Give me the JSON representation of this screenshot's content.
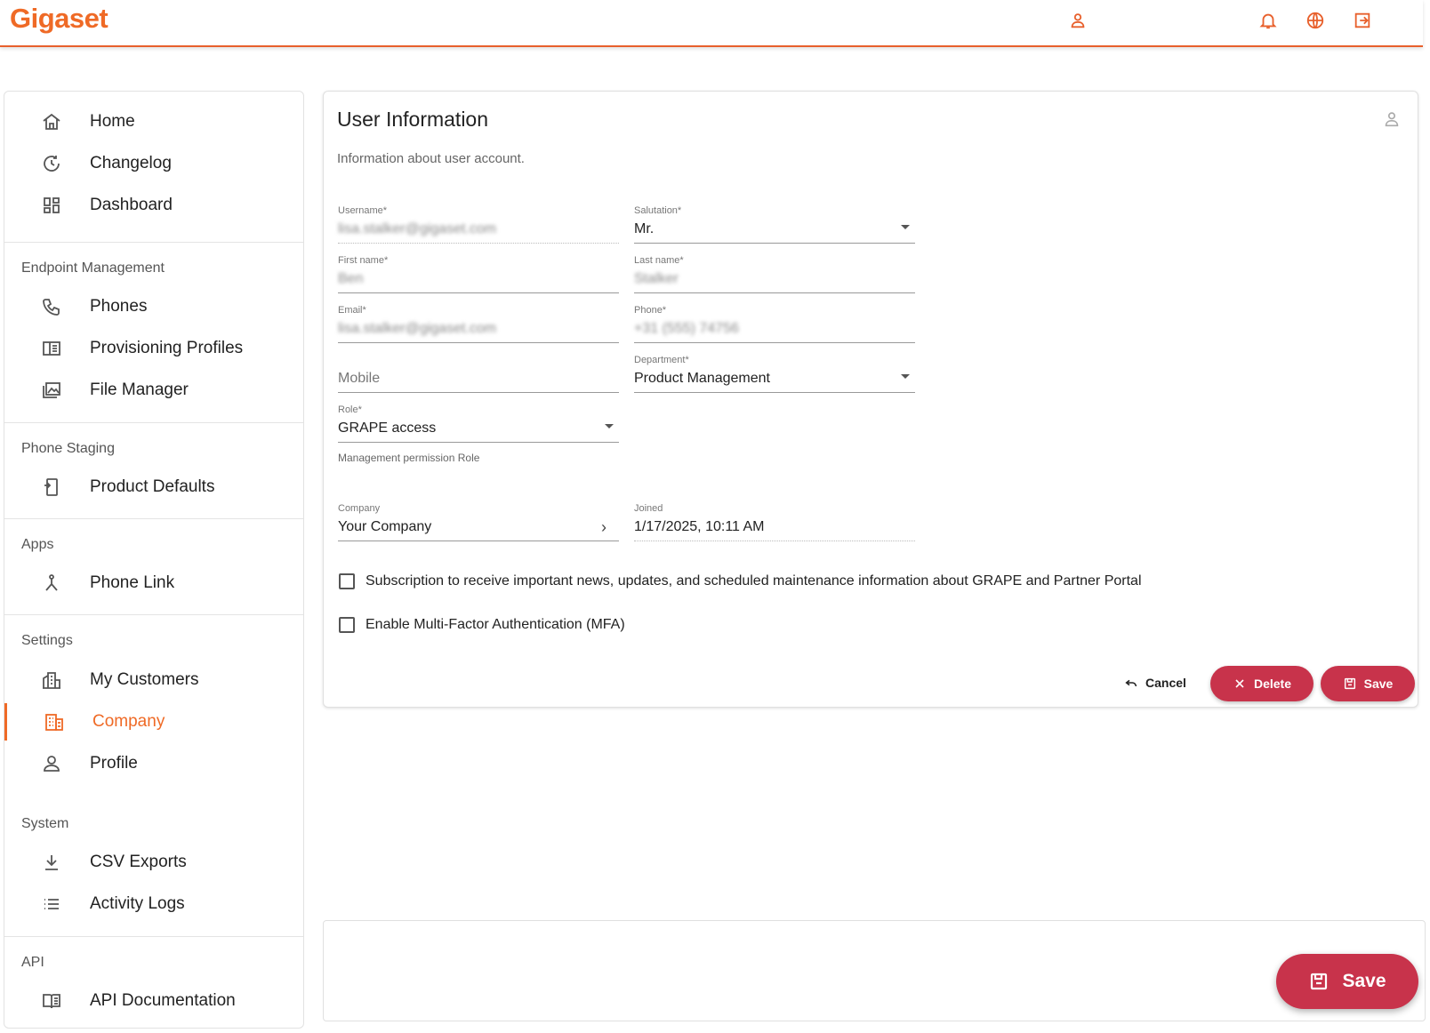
{
  "header": {
    "logo": "Gigaset",
    "icons": [
      "user-icon",
      "bell-icon",
      "globe-icon",
      "logout-icon"
    ],
    "accent_color": "#ef6a26"
  },
  "sidebar": {
    "items_top": [
      {
        "label": "Home",
        "icon": "home-icon"
      },
      {
        "label": "Changelog",
        "icon": "history-icon"
      },
      {
        "label": "Dashboard",
        "icon": "dashboard-icon"
      }
    ],
    "sections": [
      {
        "title": "Endpoint Management",
        "items": [
          {
            "label": "Phones",
            "icon": "phone-icon"
          },
          {
            "label": "Provisioning Profiles",
            "icon": "profiles-icon"
          },
          {
            "label": "File Manager",
            "icon": "images-icon"
          }
        ]
      },
      {
        "title": "Phone Staging",
        "items": [
          {
            "label": "Product Defaults",
            "icon": "device-icon"
          }
        ]
      },
      {
        "title": "Apps",
        "items": [
          {
            "label": "Phone Link",
            "icon": "link-icon"
          }
        ]
      },
      {
        "title": "Settings",
        "items": [
          {
            "label": "My Customers",
            "icon": "buildings-icon"
          },
          {
            "label": "Company",
            "icon": "company-icon",
            "active": true
          },
          {
            "label": "Profile",
            "icon": "profile-icon"
          }
        ]
      },
      {
        "title": "System",
        "items": [
          {
            "label": "CSV Exports",
            "icon": "download-icon"
          },
          {
            "label": "Activity Logs",
            "icon": "list-icon"
          }
        ]
      },
      {
        "title": "API",
        "items": [
          {
            "label": "API Documentation",
            "icon": "book-icon"
          }
        ]
      }
    ]
  },
  "card": {
    "title": "User Information",
    "subtitle": "Information about user account.",
    "fields": {
      "username": {
        "label": "Username*",
        "value": "lisa.stalker@gigaset.com"
      },
      "salutation": {
        "label": "Salutation*",
        "value": "Mr."
      },
      "first_name": {
        "label": "First name*",
        "value": "Ben"
      },
      "last_name": {
        "label": "Last name*",
        "value": "Stalker"
      },
      "email": {
        "label": "Email*",
        "value": "lisa.stalker@gigaset.com"
      },
      "phone": {
        "label": "Phone*",
        "value": "+31 (555) 74756"
      },
      "mobile": {
        "placeholder": "Mobile"
      },
      "department": {
        "label": "Department*",
        "value": "Product Management"
      },
      "role": {
        "label": "Role*",
        "value": "GRAPE access",
        "hint": "Management permission Role"
      },
      "company": {
        "label": "Company",
        "value": "Your Company"
      },
      "joined": {
        "label": "Joined",
        "value": "1/17/2025, 10:11 AM"
      }
    },
    "checkboxes": {
      "subscription": "Subscription to receive important news, updates, and scheduled maintenance information about GRAPE and Partner Portal",
      "mfa": "Enable Multi-Factor Authentication (MFA)"
    },
    "actions": {
      "cancel": "Cancel",
      "delete": "Delete",
      "save": "Save"
    }
  },
  "fab": {
    "save": "Save"
  },
  "colors": {
    "danger": "#c8334b",
    "accent": "#ef6a26"
  }
}
